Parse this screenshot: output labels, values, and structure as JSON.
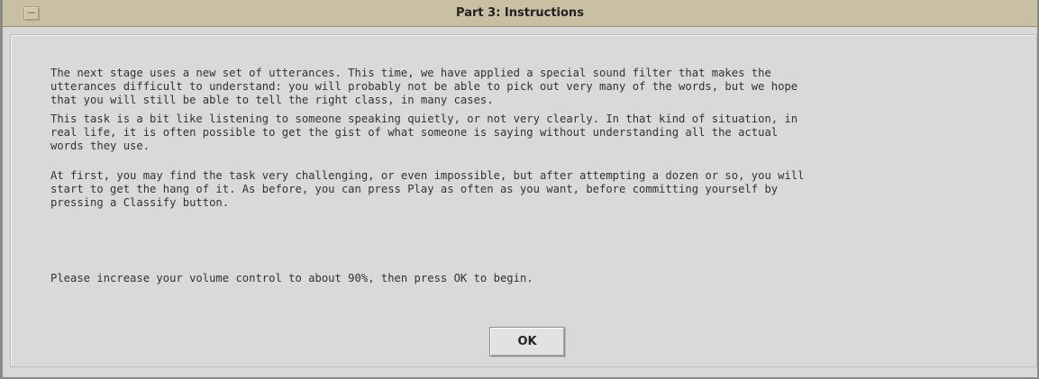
{
  "window": {
    "title": "Part 3: Instructions",
    "menu_icon": "window-menu-icon"
  },
  "instructions": {
    "paragraphs": [
      "The next stage uses a new set of utterances. This time, we have applied a special sound filter that makes the\nutterances difficult to understand: you will probably not be able to pick out very many of the words, but we hope\nthat you will still be able to tell the right class, in many cases.",
      "This task is a bit like listening to someone speaking quietly, or not very clearly. In that kind of situation, in\nreal life, it is often possible to get the gist of what someone is saying without understanding all the actual\nwords they use.",
      "At first, you may find the task very challenging, or even impossible, but after attempting a dozen or so, you will\nstart to get the hang of it. As before, you can press Play as often as you want, before committing yourself by\npressing a Classify button.",
      "Please increase your volume control to about 90%, then press OK to begin."
    ]
  },
  "buttons": {
    "ok_label": "OK"
  }
}
